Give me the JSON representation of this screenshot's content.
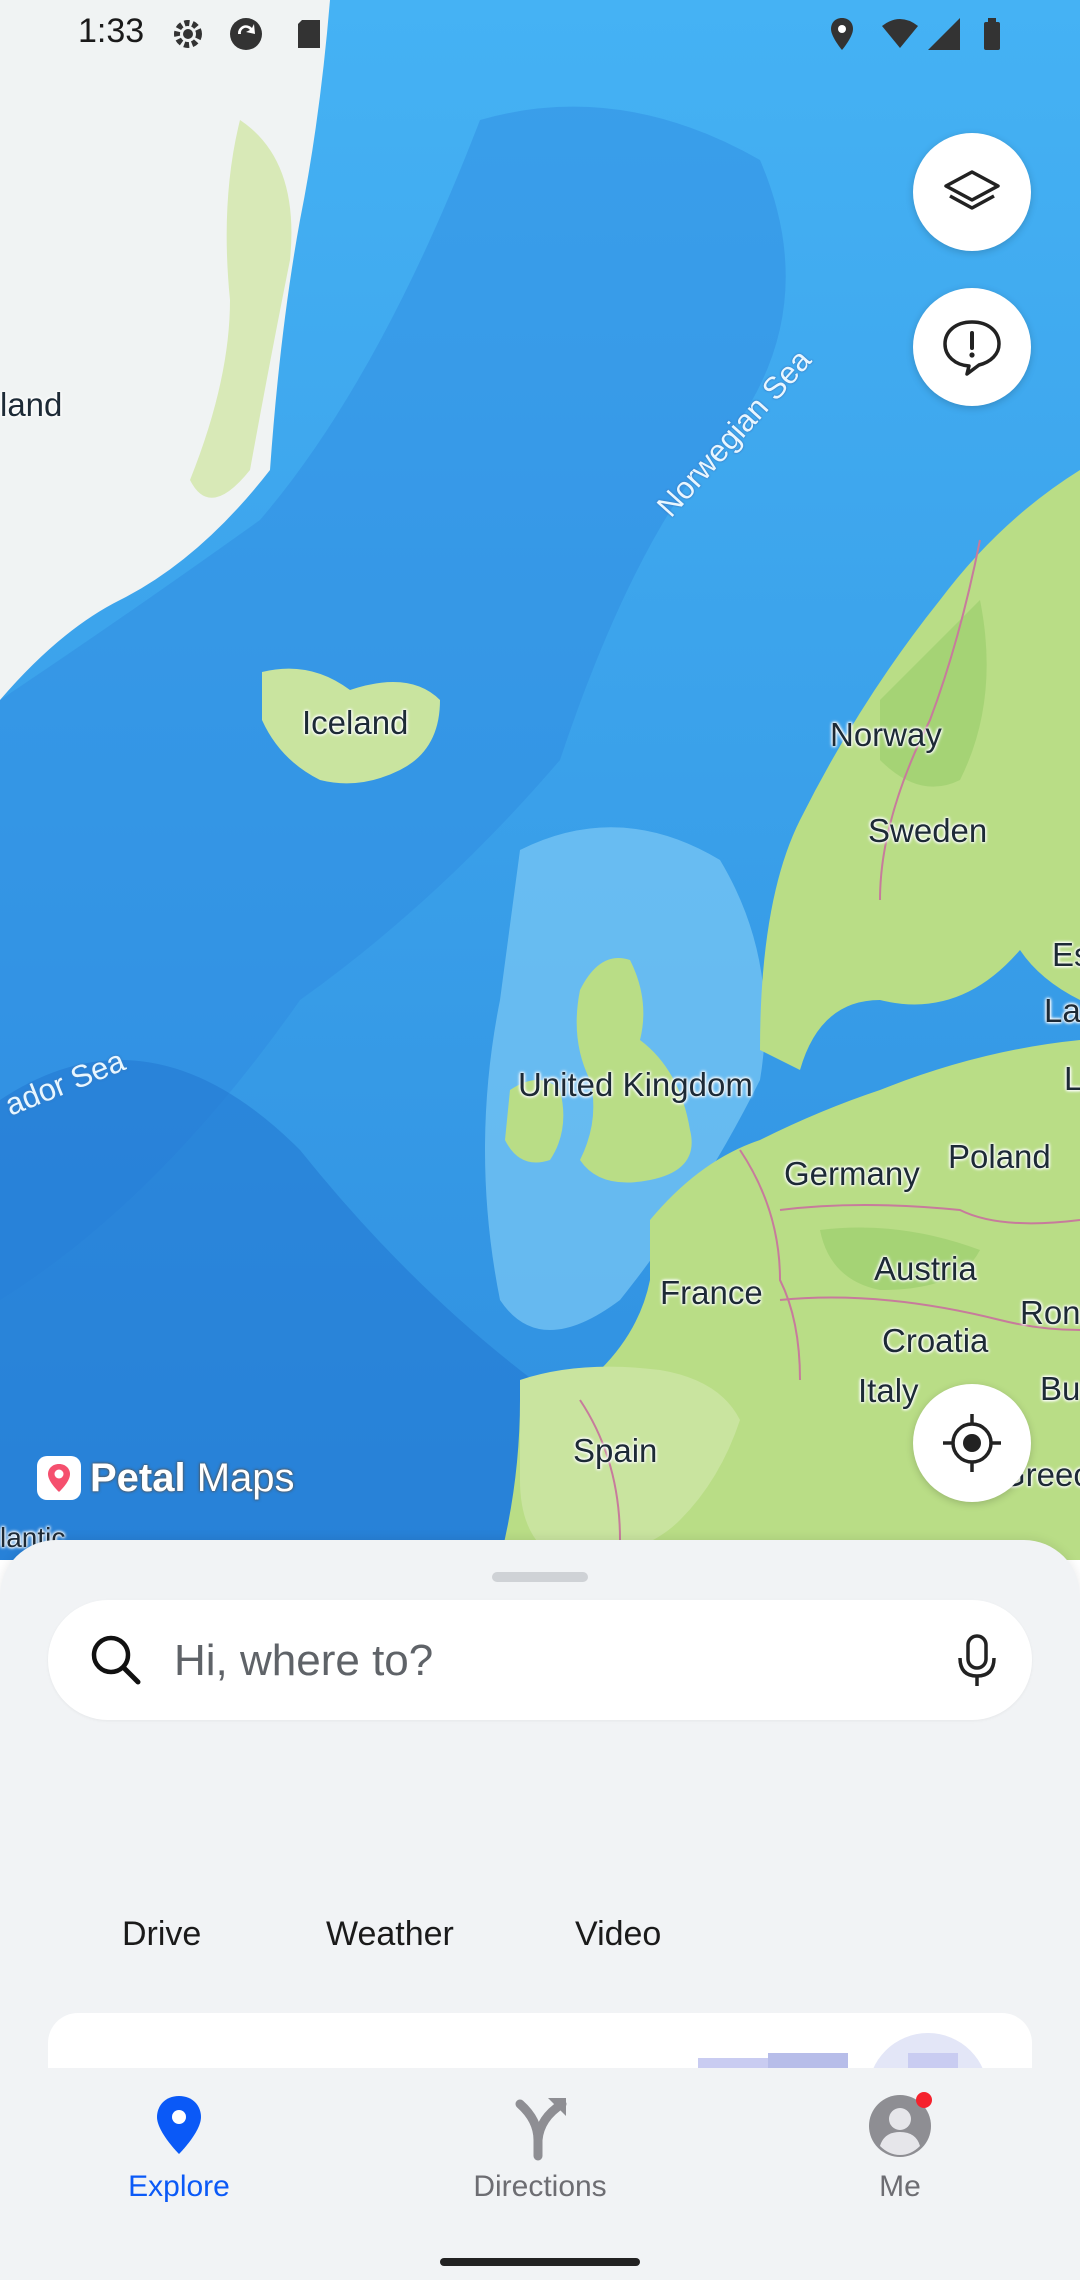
{
  "status_bar": {
    "time": "1:33"
  },
  "map": {
    "labels": {
      "iceland": "Iceland",
      "norway": "Norway",
      "sweden": "Sweden",
      "united_kingdom": "United Kingdom",
      "germany": "Germany",
      "poland": "Poland",
      "france": "France",
      "austria": "Austria",
      "croatia": "Croatia",
      "italy": "Italy",
      "spain": "Spain",
      "greenland_partial": "land",
      "estonia_partial": "Es",
      "latvia_partial": "La",
      "lithuania_partial": "Li",
      "romania_partial": "Ron",
      "bulgaria_partial": "Bu",
      "greece_partial": "Greec",
      "atlantic_partial": "lantic"
    },
    "sea_labels": {
      "norwegian_sea": "Norwegian Sea",
      "labrador_sea_partial": "ador Sea"
    }
  },
  "brand": {
    "logo_bold": "Petal",
    "logo_light": " Maps"
  },
  "search": {
    "placeholder": "Hi, where to?"
  },
  "quick_actions": [
    "Drive",
    "Weather",
    "Video"
  ],
  "nav": {
    "items": [
      {
        "label": "Explore",
        "icon": "location-pin-icon",
        "active": true
      },
      {
        "label": "Directions",
        "icon": "directions-fork-icon",
        "active": false
      },
      {
        "label": "Me",
        "icon": "avatar-icon",
        "active": false,
        "badge": true
      }
    ]
  },
  "colors": {
    "accent": "#0a59f7",
    "ocean": "#39a6f0",
    "land": "#b9dd86",
    "badge": "#f5222d"
  }
}
